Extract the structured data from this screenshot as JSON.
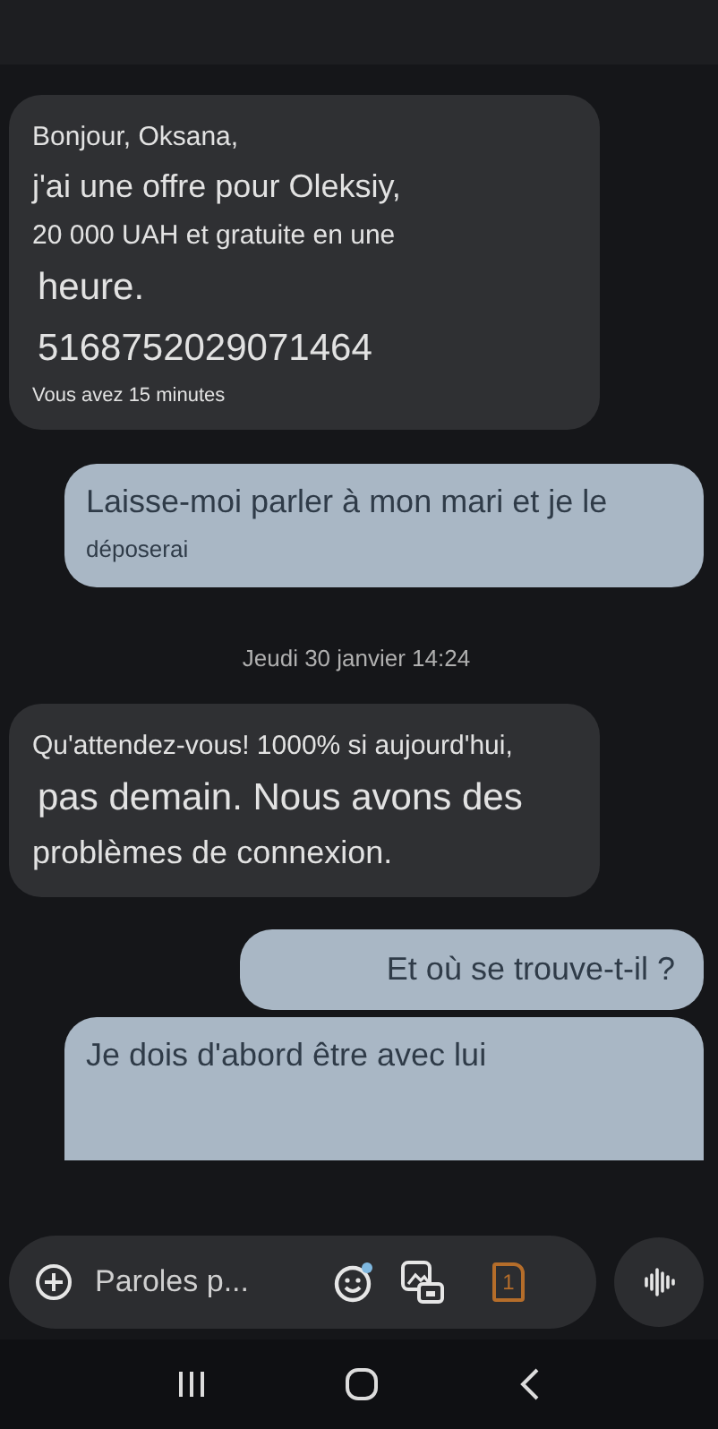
{
  "messages": [
    {
      "kind": "incoming",
      "lines": [
        {
          "text": "Bonjour, Oksana,",
          "kind": "normal"
        },
        {
          "text": "j'ai une offre pour Oleksiy,",
          "kind": "large"
        },
        {
          "text": "20 000 UAH et gratuite en une",
          "kind": "normal"
        },
        {
          "text": "heure.",
          "kind": "xlarge"
        },
        {
          "text": "5168752029071464",
          "kind": "xlarge"
        },
        {
          "text": "Vous avez 15 minutes",
          "kind": "tiny"
        }
      ]
    },
    {
      "kind": "outgoing",
      "lines": [
        {
          "text": "Laisse-moi parler à mon mari et je le",
          "kind": "large"
        },
        {
          "text": "déposerai",
          "kind": "small"
        }
      ]
    },
    {
      "kind": "date",
      "lines": [
        {
          "text": "Jeudi 30 janvier 14:24",
          "kind": "small"
        }
      ]
    },
    {
      "kind": "incoming",
      "lines": [
        {
          "text": "Qu'attendez-vous! 1000% si aujourd'hui,",
          "kind": "normal"
        },
        {
          "text": "pas demain. Nous avons des",
          "kind": "xlarge"
        },
        {
          "text": "problèmes de connexion.",
          "kind": "large"
        }
      ]
    },
    {
      "kind": "outgoing",
      "lines": [
        {
          "text": "Et où se trouve-t-il ?",
          "kind": "large"
        }
      ]
    },
    {
      "kind": "outgoing",
      "lines": [
        {
          "text": "Je dois d'abord être avec lui",
          "kind": "large"
        }
      ]
    }
  ],
  "composer": {
    "placeholder": "Paroles p...",
    "sim": "1"
  }
}
